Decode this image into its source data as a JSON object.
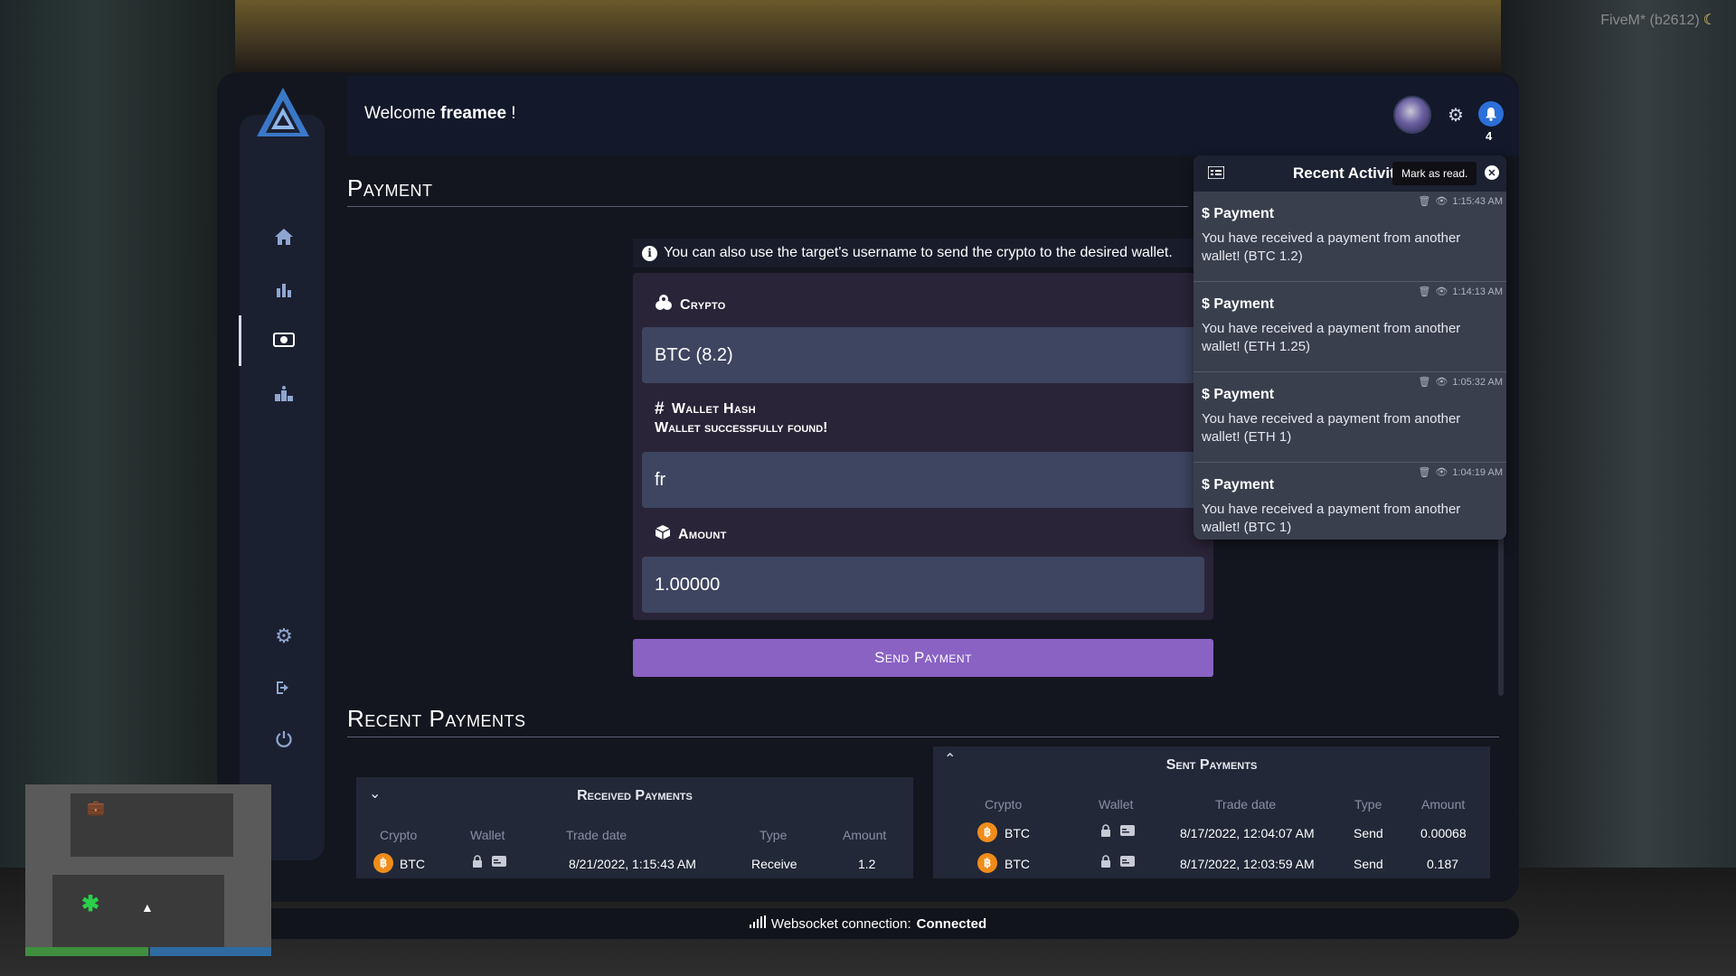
{
  "game": {
    "client_label": "FiveM* (b2612)"
  },
  "header": {
    "welcome_prefix": "Welcome",
    "username": "freamee",
    "welcome_suffix": " !",
    "notification_count": "4"
  },
  "sidebar": {
    "items": [
      {
        "name": "home",
        "icon": "home-icon"
      },
      {
        "name": "stats",
        "icon": "bar-chart-icon"
      },
      {
        "name": "payment",
        "icon": "money-bill-icon",
        "active": true
      },
      {
        "name": "ranking",
        "icon": "podium-icon"
      },
      {
        "name": "settings",
        "icon": "gear-icon"
      },
      {
        "name": "logout",
        "icon": "sign-out-icon"
      },
      {
        "name": "power",
        "icon": "power-icon"
      }
    ]
  },
  "payment": {
    "title": "Payment",
    "info": "You can also use the target's username to send the crypto to the desired wallet.",
    "crypto_label": "Crypto",
    "crypto_value": "BTC (8.2)",
    "wallet_label": "Wallet Hash",
    "wallet_status": "Wallet successfully found!",
    "wallet_value": "fr",
    "amount_label": "Amount",
    "amount_value": "1.00000",
    "send_label": "Send Payment"
  },
  "recent": {
    "title": "Recent Payments",
    "received": {
      "title": "Received Payments",
      "columns": [
        "Crypto",
        "Wallet",
        "Trade date",
        "Type",
        "Amount"
      ],
      "rows": [
        {
          "crypto": "BTC",
          "date": "8/21/2022, 1:15:43 AM",
          "type": "Receive",
          "amount": "1.2"
        }
      ]
    },
    "sent": {
      "title": "Sent Payments",
      "columns": [
        "Crypto",
        "Wallet",
        "Trade date",
        "Type",
        "Amount"
      ],
      "rows": [
        {
          "crypto": "BTC",
          "date": "8/17/2022, 12:04:07 AM",
          "type": "Send",
          "amount": "0.00068"
        },
        {
          "crypto": "BTC",
          "date": "8/17/2022, 12:03:59 AM",
          "type": "Send",
          "amount": "0.187"
        }
      ]
    }
  },
  "notifications": {
    "title": "Recent Activities",
    "tooltip": "Mark as read.",
    "items": [
      {
        "title": "Payment",
        "time": "1:15:43 AM",
        "message": "You have received a payment from another wallet! (BTC 1.2)"
      },
      {
        "title": "Payment",
        "time": "1:14:13 AM",
        "message": "You have received a payment from another wallet! (ETH 1.25)"
      },
      {
        "title": "Payment",
        "time": "1:05:32 AM",
        "message": "You have received a payment from another wallet! (ETH 1)"
      },
      {
        "title": "Payment",
        "time": "1:04:19 AM",
        "message": "You have received a payment from another wallet! (BTC 1)"
      }
    ]
  },
  "status": {
    "label": "Websocket connection:",
    "value": "Connected"
  },
  "colors": {
    "accent": "#8a62c4",
    "btc": "#f08c1a",
    "bell": "#2b6fd8"
  }
}
